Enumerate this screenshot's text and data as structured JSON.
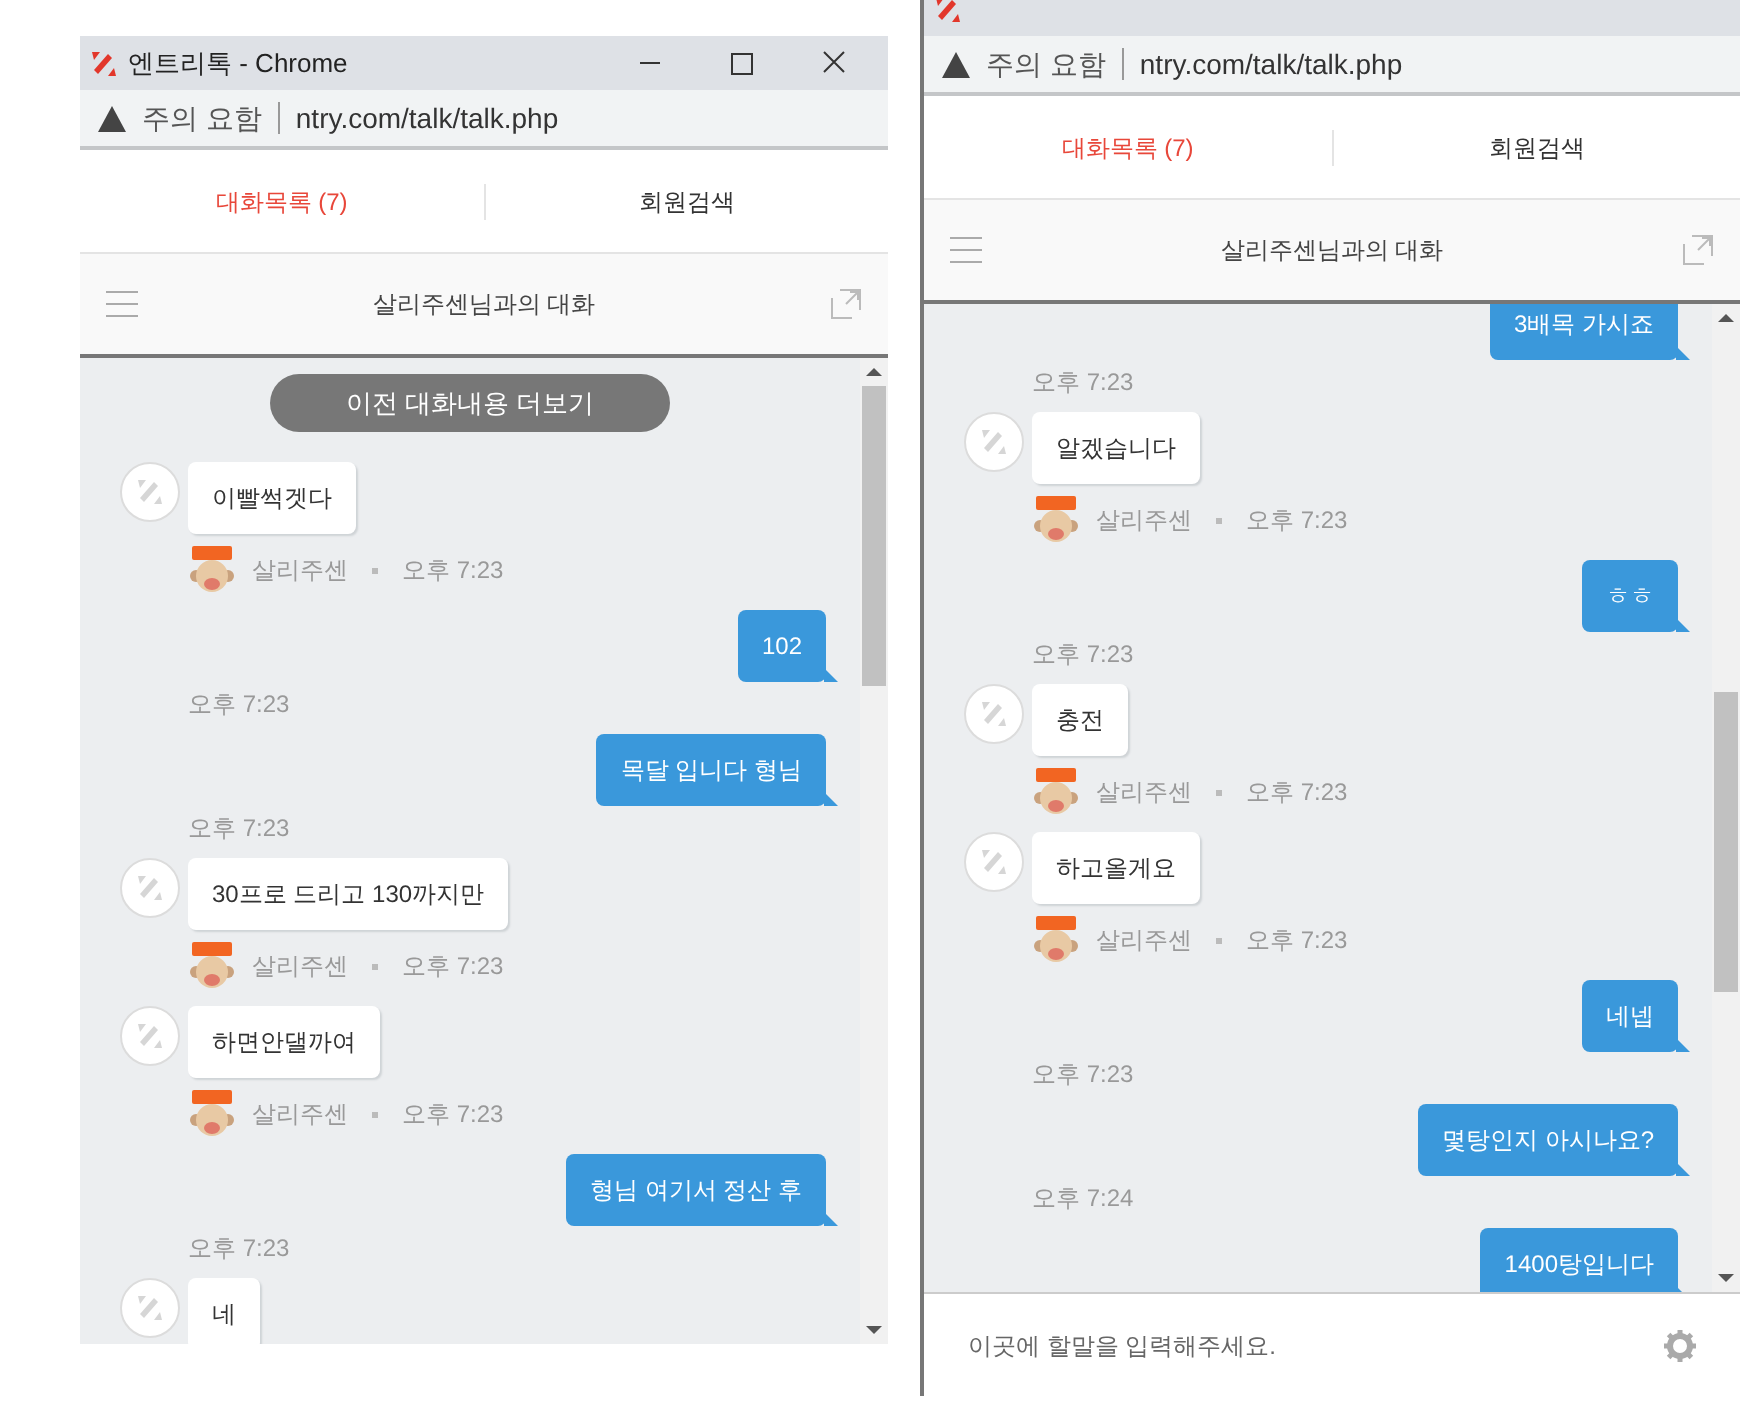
{
  "windows": [
    {
      "title": "엔트리톡 - Chrome",
      "warning": "주의 요함",
      "url": "ntry.com/talk/talk.php",
      "tabs": [
        {
          "label": "대화목록 (7)",
          "selected": true
        },
        {
          "label": "회원검색",
          "selected": false
        }
      ],
      "chat_title": "살리주센님과의 대화",
      "load_more": "이전 대화내용 더보기",
      "messages": [
        {
          "kind": "received",
          "text": "이빨썩겟다",
          "sender": "살리주센",
          "time": "오후 7:23"
        },
        {
          "kind": "sent",
          "text": "102",
          "time": "오후 7:23"
        },
        {
          "kind": "sent",
          "text": "목달 입니다 형님",
          "time": "오후 7:23"
        },
        {
          "kind": "received",
          "text": "30프로 드리고 130까지만",
          "sender": "살리주센",
          "time": "오후 7:23"
        },
        {
          "kind": "received",
          "text": "하면안댈까여",
          "sender": "살리주센",
          "time": "오후 7:23"
        },
        {
          "kind": "sent",
          "text": "형님 여기서 정산 후",
          "time": "오후 7:23"
        },
        {
          "kind": "received",
          "text": "네"
        }
      ]
    },
    {
      "warning": "주의 요함",
      "url": "ntry.com/talk/talk.php",
      "tabs": [
        {
          "label": "대화목록 (7)",
          "selected": true
        },
        {
          "label": "회원검색",
          "selected": false
        }
      ],
      "chat_title": "살리주센님과의 대화",
      "messages": [
        {
          "kind": "sent",
          "text": "3배목 가시죠",
          "time": "오후 7:23"
        },
        {
          "kind": "received",
          "text": "알겠습니다",
          "sender": "살리주센",
          "time": "오후 7:23"
        },
        {
          "kind": "sent",
          "text": "ㅎㅎ",
          "time": "오후 7:23"
        },
        {
          "kind": "received",
          "text": "충전",
          "sender": "살리주센",
          "time": "오후 7:23"
        },
        {
          "kind": "received",
          "text": "하고올게요",
          "sender": "살리주센",
          "time": "오후 7:23"
        },
        {
          "kind": "sent",
          "text": "네넵",
          "time": "오후 7:23"
        },
        {
          "kind": "sent",
          "text": "몇탕인지 아시나요?",
          "time": "오후 7:24"
        },
        {
          "kind": "sent",
          "text": "1400탕입니다"
        }
      ],
      "input": {
        "placeholder": "이곳에 할말을 입력해주세요."
      }
    }
  ]
}
